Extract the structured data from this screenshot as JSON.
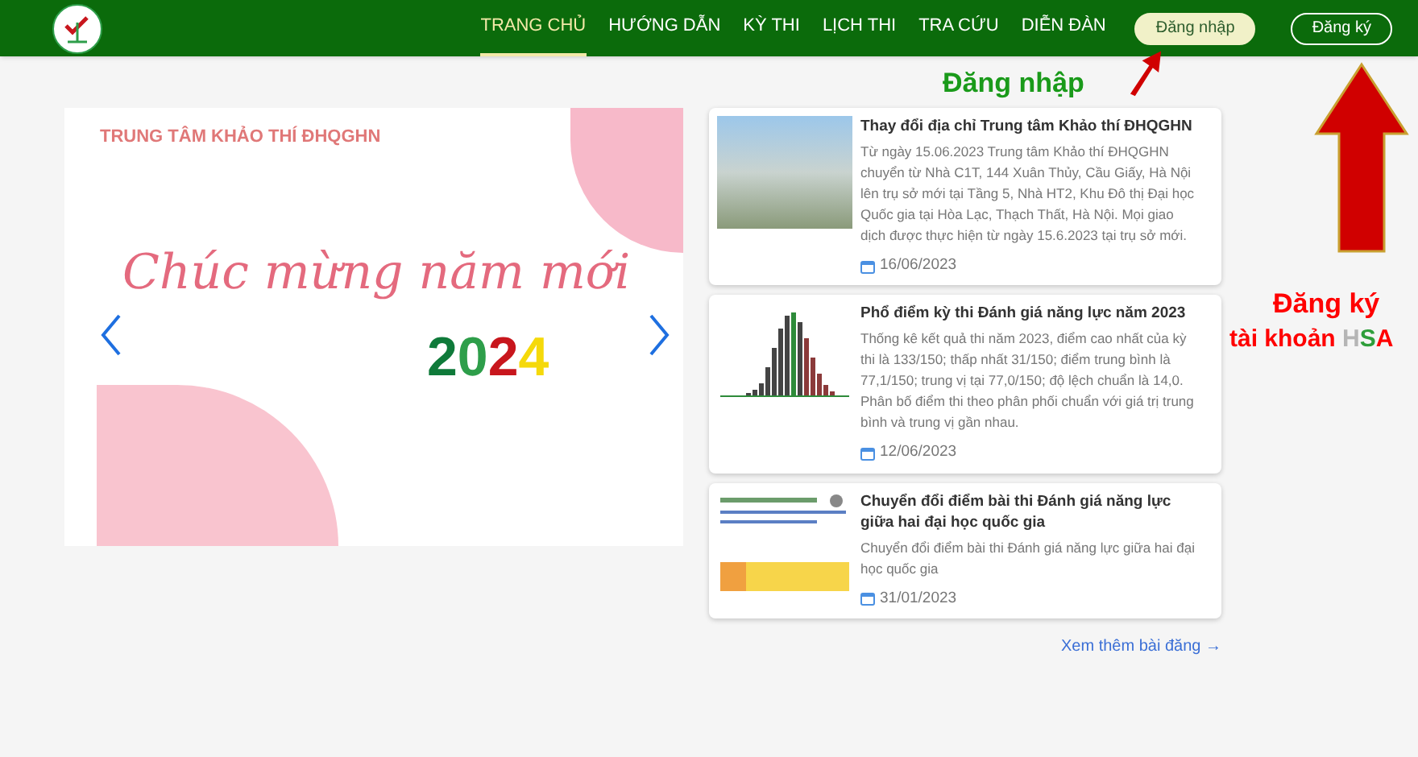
{
  "header": {
    "nav": [
      {
        "label": "TRANG CHỦ",
        "selected": true
      },
      {
        "label": "HƯỚNG DẪN",
        "selected": false
      },
      {
        "label": "KỲ THI",
        "selected": false
      },
      {
        "label": "LỊCH THI",
        "selected": false
      },
      {
        "label": "TRA CỨU",
        "selected": false
      },
      {
        "label": "DIỄN ĐÀN",
        "selected": false
      }
    ],
    "buttons": [
      {
        "label": "Đăng nhập",
        "kind": "filled"
      },
      {
        "label": "Đăng ký",
        "kind": "outline"
      }
    ]
  },
  "banner": {
    "org": "TRUNG TÂM KHẢO THÍ ĐHQGHN",
    "greeting": "Chúc mừng năm mới",
    "year": [
      {
        "text": "2",
        "color": "#0f7a3a"
      },
      {
        "text": "0",
        "color": "#2e9e4a"
      },
      {
        "text": "2",
        "color": "#c8161d"
      },
      {
        "text": "4",
        "color": "#f5d90a"
      }
    ]
  },
  "posts": [
    {
      "title": "Thay đổi địa chỉ Trung tâm Khảo thí ĐHQGHN",
      "summary": "Từ ngày 15.06.2023 Trung tâm Khảo thí ĐHQGHN chuyển từ Nhà C1T, 144 Xuân Thủy, Cầu Giấy, Hà Nội lên trụ sở mới tại Tầng 5, Nhà HT2, Khu Đô thị Đại học Quốc gia tại Hòa Lạc, Thạch Thất, Hà Nội. Mọi giao dịch được thực hiện từ ngày 15.6.2023 tại trụ sở mới.",
      "date": "16/06/2023",
      "kind": "photo"
    },
    {
      "title": "Phổ điểm kỳ thi Đánh giá năng lực năm 2023",
      "summary": "Thống kê kết quả thi năm 2023, điểm cao nhất của kỳ thi là 133/150; thấp nhất 31/150; điểm trung bình là 77,1/150; trung vị tại 77,0/150; độ lệch chuẩn là 14,0. Phân bố điểm thi theo phân phối chuẩn với giá trị trung bình và trung vị gần nhau.",
      "date": "12/06/2023",
      "kind": "histogram"
    },
    {
      "title": "Chuyển đổi điểm bài thi Đánh giá năng lực giữa hai đại học quốc gia",
      "summary": "Chuyển đổi điểm bài thi Đánh giá năng lực giữa hai đại học quốc gia",
      "date": "31/01/2023",
      "kind": "document"
    }
  ],
  "more_link": "Xem thêm bài đăng →",
  "annotations": {
    "login": "Đăng nhập",
    "register_line1": "Đăng ký",
    "register_line2": [
      {
        "text": "tài khoản ",
        "color": "#ff0000"
      },
      {
        "text": "H",
        "color": "#b5b5b5"
      },
      {
        "text": "S",
        "color": "#2e9e3a"
      },
      {
        "text": "A",
        "color": "#ff0000"
      }
    ]
  }
}
